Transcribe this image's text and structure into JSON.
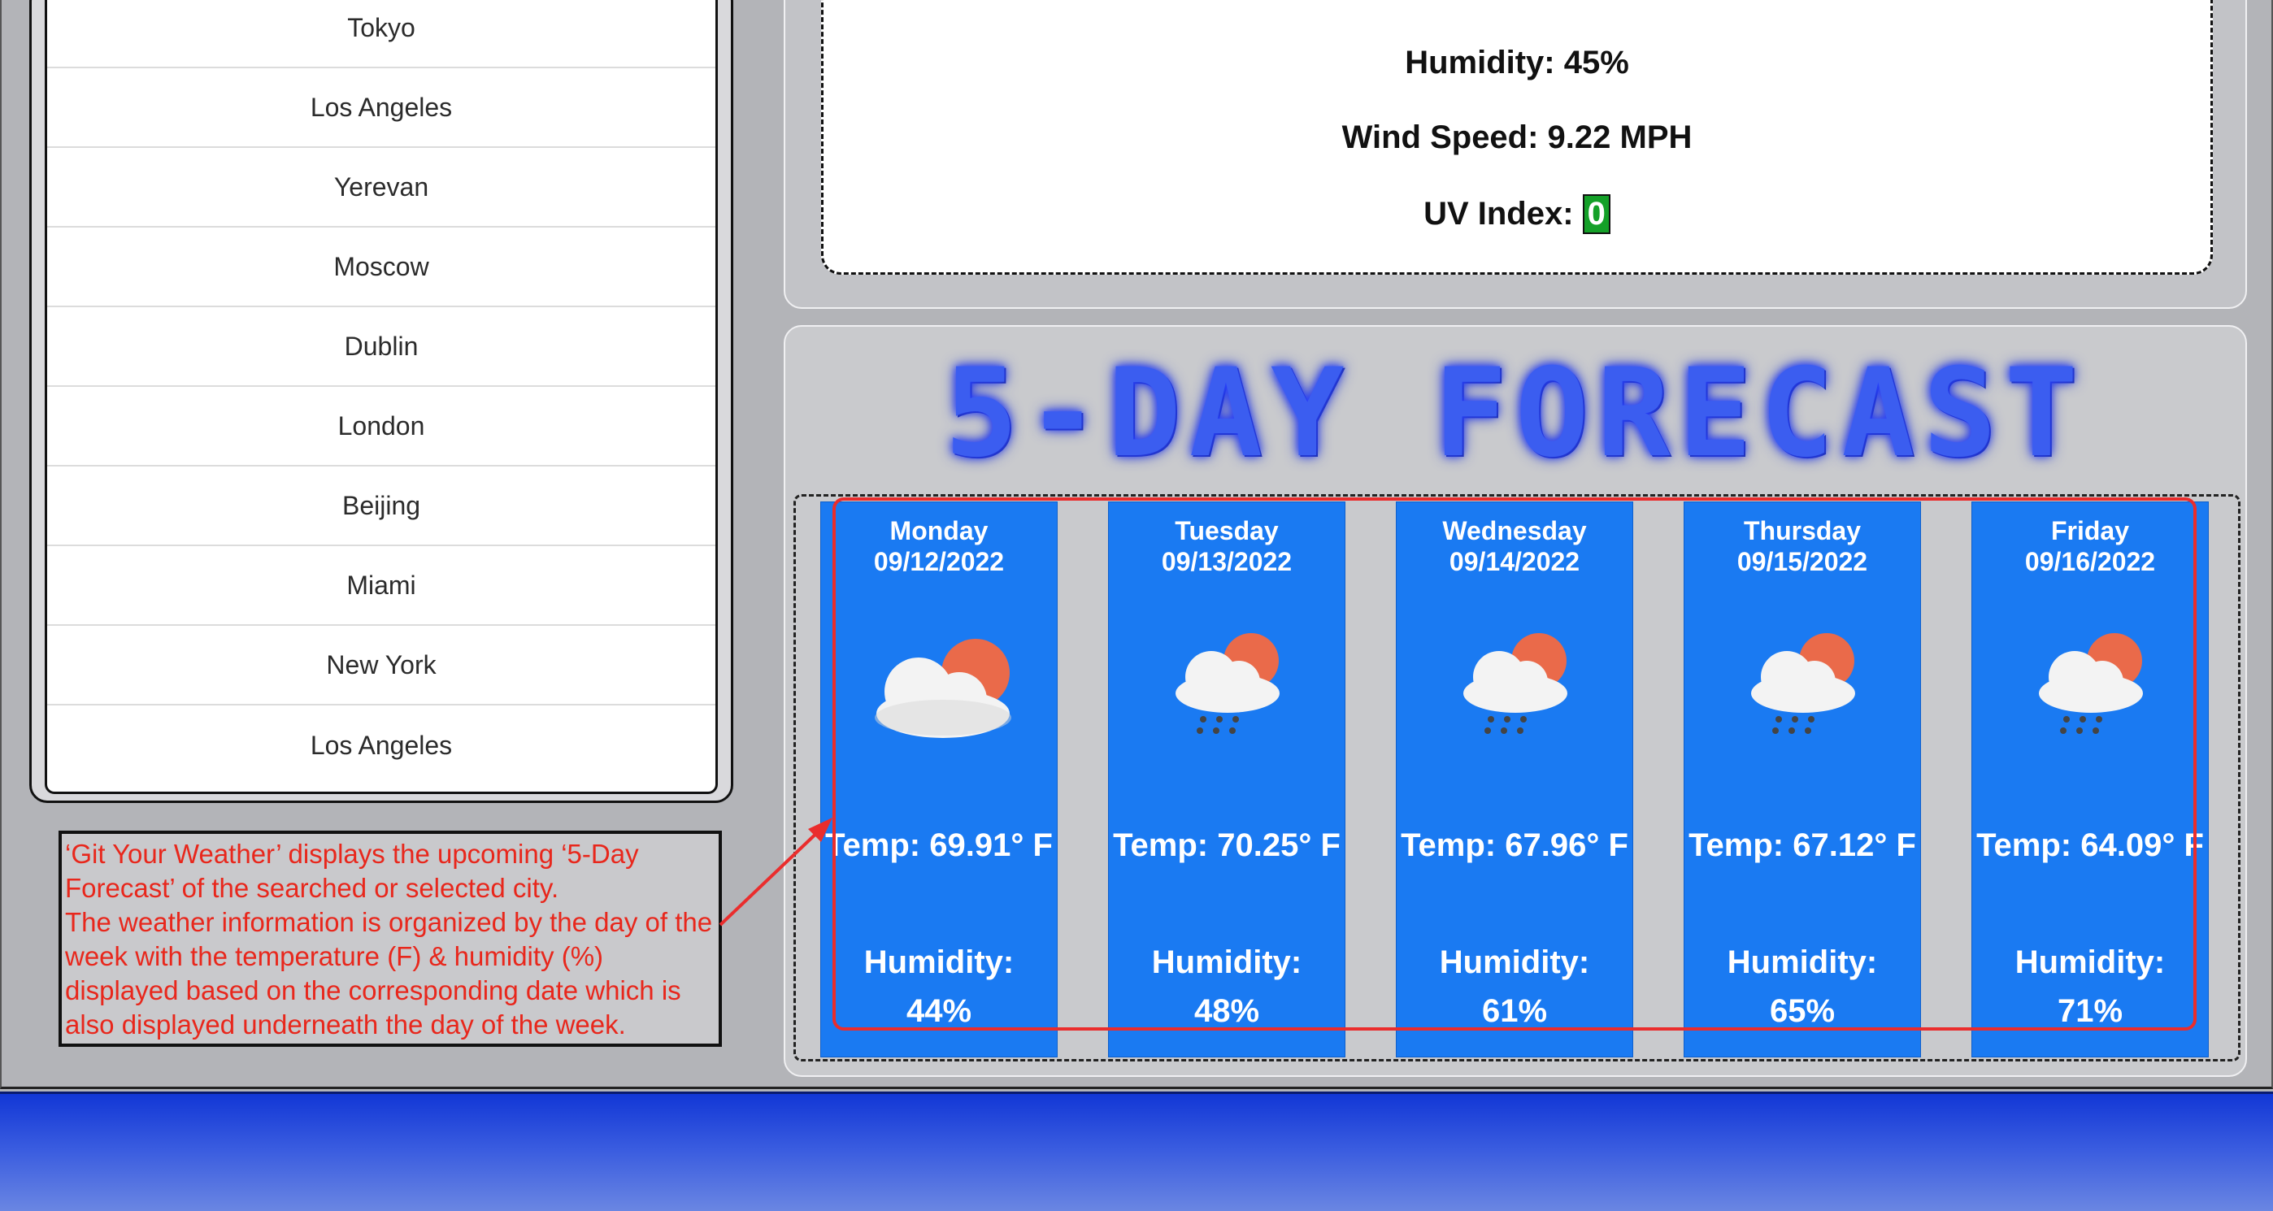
{
  "history": {
    "cities": [
      "Tokyo",
      "Los Angeles",
      "Yerevan",
      "Moscow",
      "Dublin",
      "London",
      "Beijing",
      "Miami",
      "New York",
      "Los Angeles"
    ]
  },
  "current": {
    "humidity": "Humidity: 45%",
    "wind": "Wind Speed: 9.22 MPH",
    "uv_label": "UV Index: ",
    "uv_value": "0",
    "uv_color": "#14a028"
  },
  "forecast": {
    "title": "5-DAY FORECAST",
    "days": [
      {
        "day": "Monday",
        "date": "09/12/2022",
        "temp": "Temp: 69.91° F",
        "humidity_label": "Humidity:",
        "humidity_value": "44%",
        "icon": "partly-cloudy-icon"
      },
      {
        "day": "Tuesday",
        "date": "09/13/2022",
        "temp": "Temp: 70.25° F",
        "humidity_label": "Humidity:",
        "humidity_value": "48%",
        "icon": "rain-sun-icon"
      },
      {
        "day": "Wednesday",
        "date": "09/14/2022",
        "temp": "Temp: 67.96° F",
        "humidity_label": "Humidity:",
        "humidity_value": "61%",
        "icon": "rain-sun-icon"
      },
      {
        "day": "Thursday",
        "date": "09/15/2022",
        "temp": "Temp: 67.12° F",
        "humidity_label": "Humidity:",
        "humidity_value": "65%",
        "icon": "rain-sun-icon"
      },
      {
        "day": "Friday",
        "date": "09/16/2022",
        "temp": "Temp: 64.09° F",
        "humidity_label": "Humidity:",
        "humidity_value": "71%",
        "icon": "rain-sun-icon"
      }
    ]
  },
  "annotation": {
    "line1": "‘Git Your Weather’ displays the upcoming ‘5-Day Forecast’ of the searched or selected city.",
    "line2": "The weather information is organized by the day of the week with the temperature (F) & humidity (%) displayed based on the corresponding date which is also displayed underneath the day of the week."
  },
  "colors": {
    "card_blue": "#1a7af2",
    "annotation_red": "#e8271c",
    "highlight_red": "#ea2d2d"
  }
}
